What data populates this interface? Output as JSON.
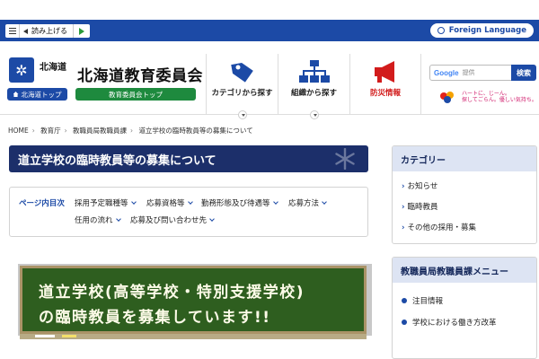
{
  "topbar": {
    "read_aloud_label": "読み上げる",
    "foreign_language_label": "Foreign Language"
  },
  "header": {
    "logo_text": "北海道",
    "hokkaido_top_label": "北海道トップ",
    "site_title": "北海道教育委員会",
    "board_top_label": "教育委員会トップ",
    "nav": {
      "category_label": "カテゴリから探す",
      "org_label": "組織から探す",
      "disaster_label": "防災情報"
    },
    "search": {
      "google_label": "Google",
      "placeholder": "提供",
      "button_label": "検索"
    },
    "heart_text_line1": "ハートに、じーん。",
    "heart_text_line2": "探してごらん。優しい気持ち。"
  },
  "breadcrumb": [
    "HOME",
    "教育庁",
    "教職員局教職員課",
    "道立学校の臨時教員等の募集について"
  ],
  "page_title": "道立学校の臨時教員等の募集について",
  "toc": {
    "heading": "ページ内目次",
    "items": [
      "採用予定職種等",
      "応募資格等",
      "勤務形態及び待遇等",
      "応募方法",
      "任用の流れ",
      "応募及び問い合わせ先"
    ]
  },
  "banner": {
    "line1": "道立学校(高等学校・特別支援学校)",
    "line2": "の臨時教員を募集しています!!"
  },
  "sidebar": {
    "category_heading": "カテゴリー",
    "category_items": [
      "お知らせ",
      "臨時教員",
      "その他の採用・募集"
    ],
    "menu_heading": "教職員局教職員課メニュー",
    "menu_items": [
      "注目情報",
      "学校における働き方改革"
    ]
  },
  "colors": {
    "brand_blue": "#1c4aa6",
    "title_navy": "#1c2f6a",
    "board_green": "#1e8a3e",
    "chalkboard": "#2e5e1f",
    "disaster_red": "#d21c1c"
  }
}
